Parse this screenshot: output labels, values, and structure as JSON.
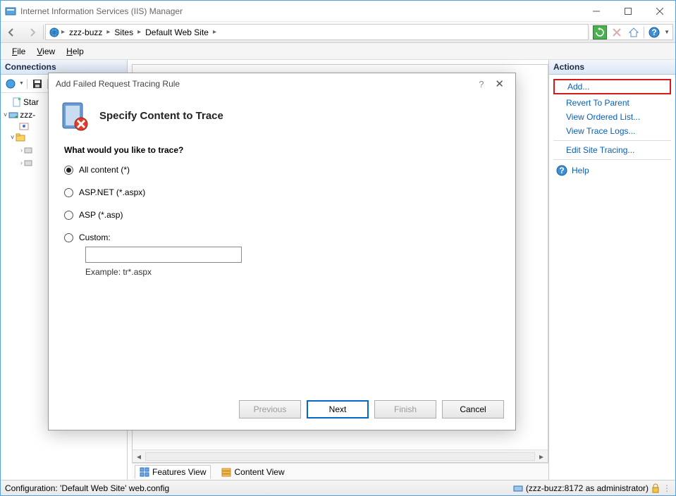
{
  "window": {
    "title": "Internet Information Services (IIS) Manager"
  },
  "breadcrumb": {
    "root": "zzz-buzz",
    "mid": "Sites",
    "leaf": "Default Web Site"
  },
  "menu": {
    "file": "File",
    "view": "View",
    "help": "Help"
  },
  "connections": {
    "header": "Connections",
    "items": {
      "start": "Star",
      "host": "zzz-"
    }
  },
  "actions": {
    "header": "Actions",
    "add": "Add...",
    "revert": "Revert To Parent",
    "ordered": "View Ordered List...",
    "logs": "View Trace Logs...",
    "editsite": "Edit Site Tracing...",
    "help": "Help"
  },
  "views": {
    "features": "Features View",
    "content": "Content View"
  },
  "status": {
    "left": "Configuration: 'Default Web Site' web.config",
    "right": "(zzz-buzz:8172 as administrator)"
  },
  "dialog": {
    "title": "Add Failed Request Tracing Rule",
    "heading": "Specify Content to Trace",
    "question": "What would you like to trace?",
    "opts": {
      "all": "All content (*)",
      "aspnet": "ASP.NET (*.aspx)",
      "asp": "ASP (*.asp)",
      "custom": "Custom:"
    },
    "example": "Example: tr*.aspx",
    "buttons": {
      "prev": "Previous",
      "next": "Next",
      "finish": "Finish",
      "cancel": "Cancel"
    }
  }
}
